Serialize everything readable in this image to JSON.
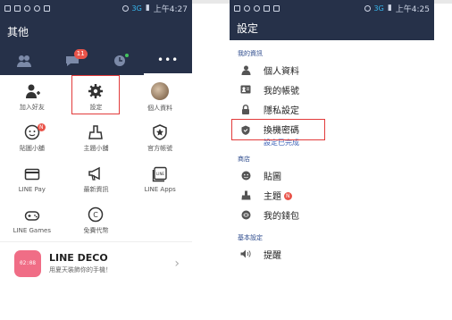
{
  "colors": {
    "header": "#263149",
    "accent": "#e23b3b",
    "link": "#3c62b7",
    "badge": "#e9544a"
  },
  "left": {
    "status": {
      "time": "上午4:27",
      "network": "3G"
    },
    "title": "其他",
    "tabs": [
      {
        "icon": "friends-icon"
      },
      {
        "icon": "chat-icon",
        "badge": "11"
      },
      {
        "icon": "timeline-icon"
      },
      {
        "icon": "more-icon",
        "label": "•••"
      }
    ],
    "grid": [
      {
        "label": "加入好友",
        "icon": "add-friend-icon"
      },
      {
        "label": "設定",
        "icon": "gear-icon"
      },
      {
        "label": "個人資料",
        "icon": "avatar"
      },
      {
        "label": "貼圖小舖",
        "icon": "sticker-shop-icon",
        "badge": "N"
      },
      {
        "label": "主題小舖",
        "icon": "theme-shop-icon"
      },
      {
        "label": "官方帳號",
        "icon": "official-account-icon"
      },
      {
        "label": "LINE Pay",
        "icon": "line-pay-icon"
      },
      {
        "label": "最新資訊",
        "icon": "megaphone-icon"
      },
      {
        "label": "LINE Apps",
        "icon": "line-apps-icon"
      },
      {
        "label": "LINE Games",
        "icon": "gamepad-icon"
      },
      {
        "label": "免費代幣",
        "icon": "coin-icon"
      }
    ],
    "deco": {
      "title": "LINE DECO",
      "subtitle": "用夏天裝飾你的手機！",
      "logo_text": "02:08"
    }
  },
  "right": {
    "status": {
      "time": "上午4:25",
      "network": "3G"
    },
    "title": "設定",
    "sections": [
      {
        "header": "我的資訊",
        "rows": [
          {
            "label": "個人資料",
            "icon": "person-icon"
          },
          {
            "label": "我的帳號",
            "icon": "id-card-icon"
          },
          {
            "label": "隱私設定",
            "icon": "lock-icon"
          },
          {
            "label": "換機密碼",
            "icon": "shield-icon",
            "sub": "設定已完成"
          }
        ]
      },
      {
        "header": "商店",
        "rows": [
          {
            "label": "貼圖",
            "icon": "sticker-icon"
          },
          {
            "label": "主題",
            "icon": "theme-icon",
            "badge": "N"
          },
          {
            "label": "我的錢包",
            "icon": "wallet-icon"
          }
        ]
      },
      {
        "header": "基本設定",
        "rows": [
          {
            "label": "提醒",
            "icon": "speaker-icon"
          }
        ]
      }
    ]
  }
}
